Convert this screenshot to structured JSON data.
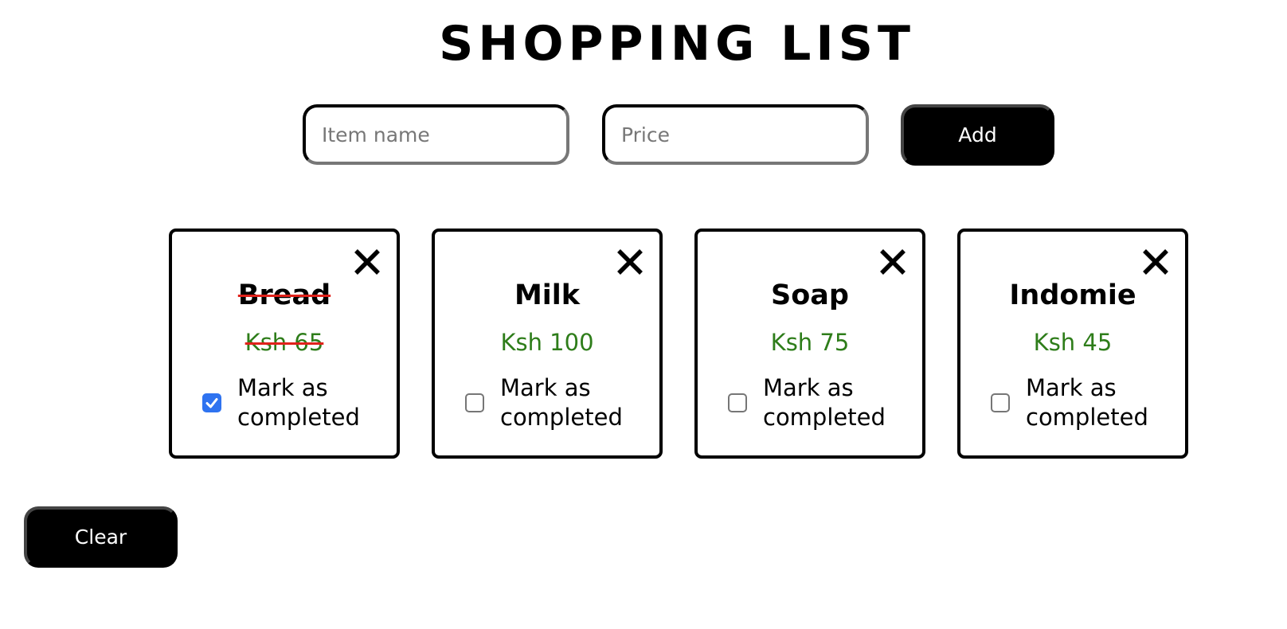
{
  "header": {
    "title": "SHOPPING LIST"
  },
  "form": {
    "item_name_placeholder": "Item name",
    "price_placeholder": "Price",
    "add_label": "Add"
  },
  "items": [
    {
      "name": "Bread",
      "price": "Ksh 65",
      "completed": true,
      "mark_label": "Mark as completed"
    },
    {
      "name": "Milk",
      "price": "Ksh 100",
      "completed": false,
      "mark_label": "Mark as completed"
    },
    {
      "name": "Soap",
      "price": "Ksh 75",
      "completed": false,
      "mark_label": "Mark as completed"
    },
    {
      "name": "Indomie",
      "price": "Ksh 45",
      "completed": false,
      "mark_label": "Mark as completed"
    }
  ],
  "footer": {
    "clear_label": "Clear"
  },
  "colors": {
    "price_text": "#2e7d1a",
    "strikethrough": "#e0221b",
    "checkbox_checked": "#2f73f0",
    "button_bg": "#000000",
    "button_text": "#ffffff"
  },
  "icons": {
    "close": "close-icon",
    "check": "checkmark-icon"
  }
}
